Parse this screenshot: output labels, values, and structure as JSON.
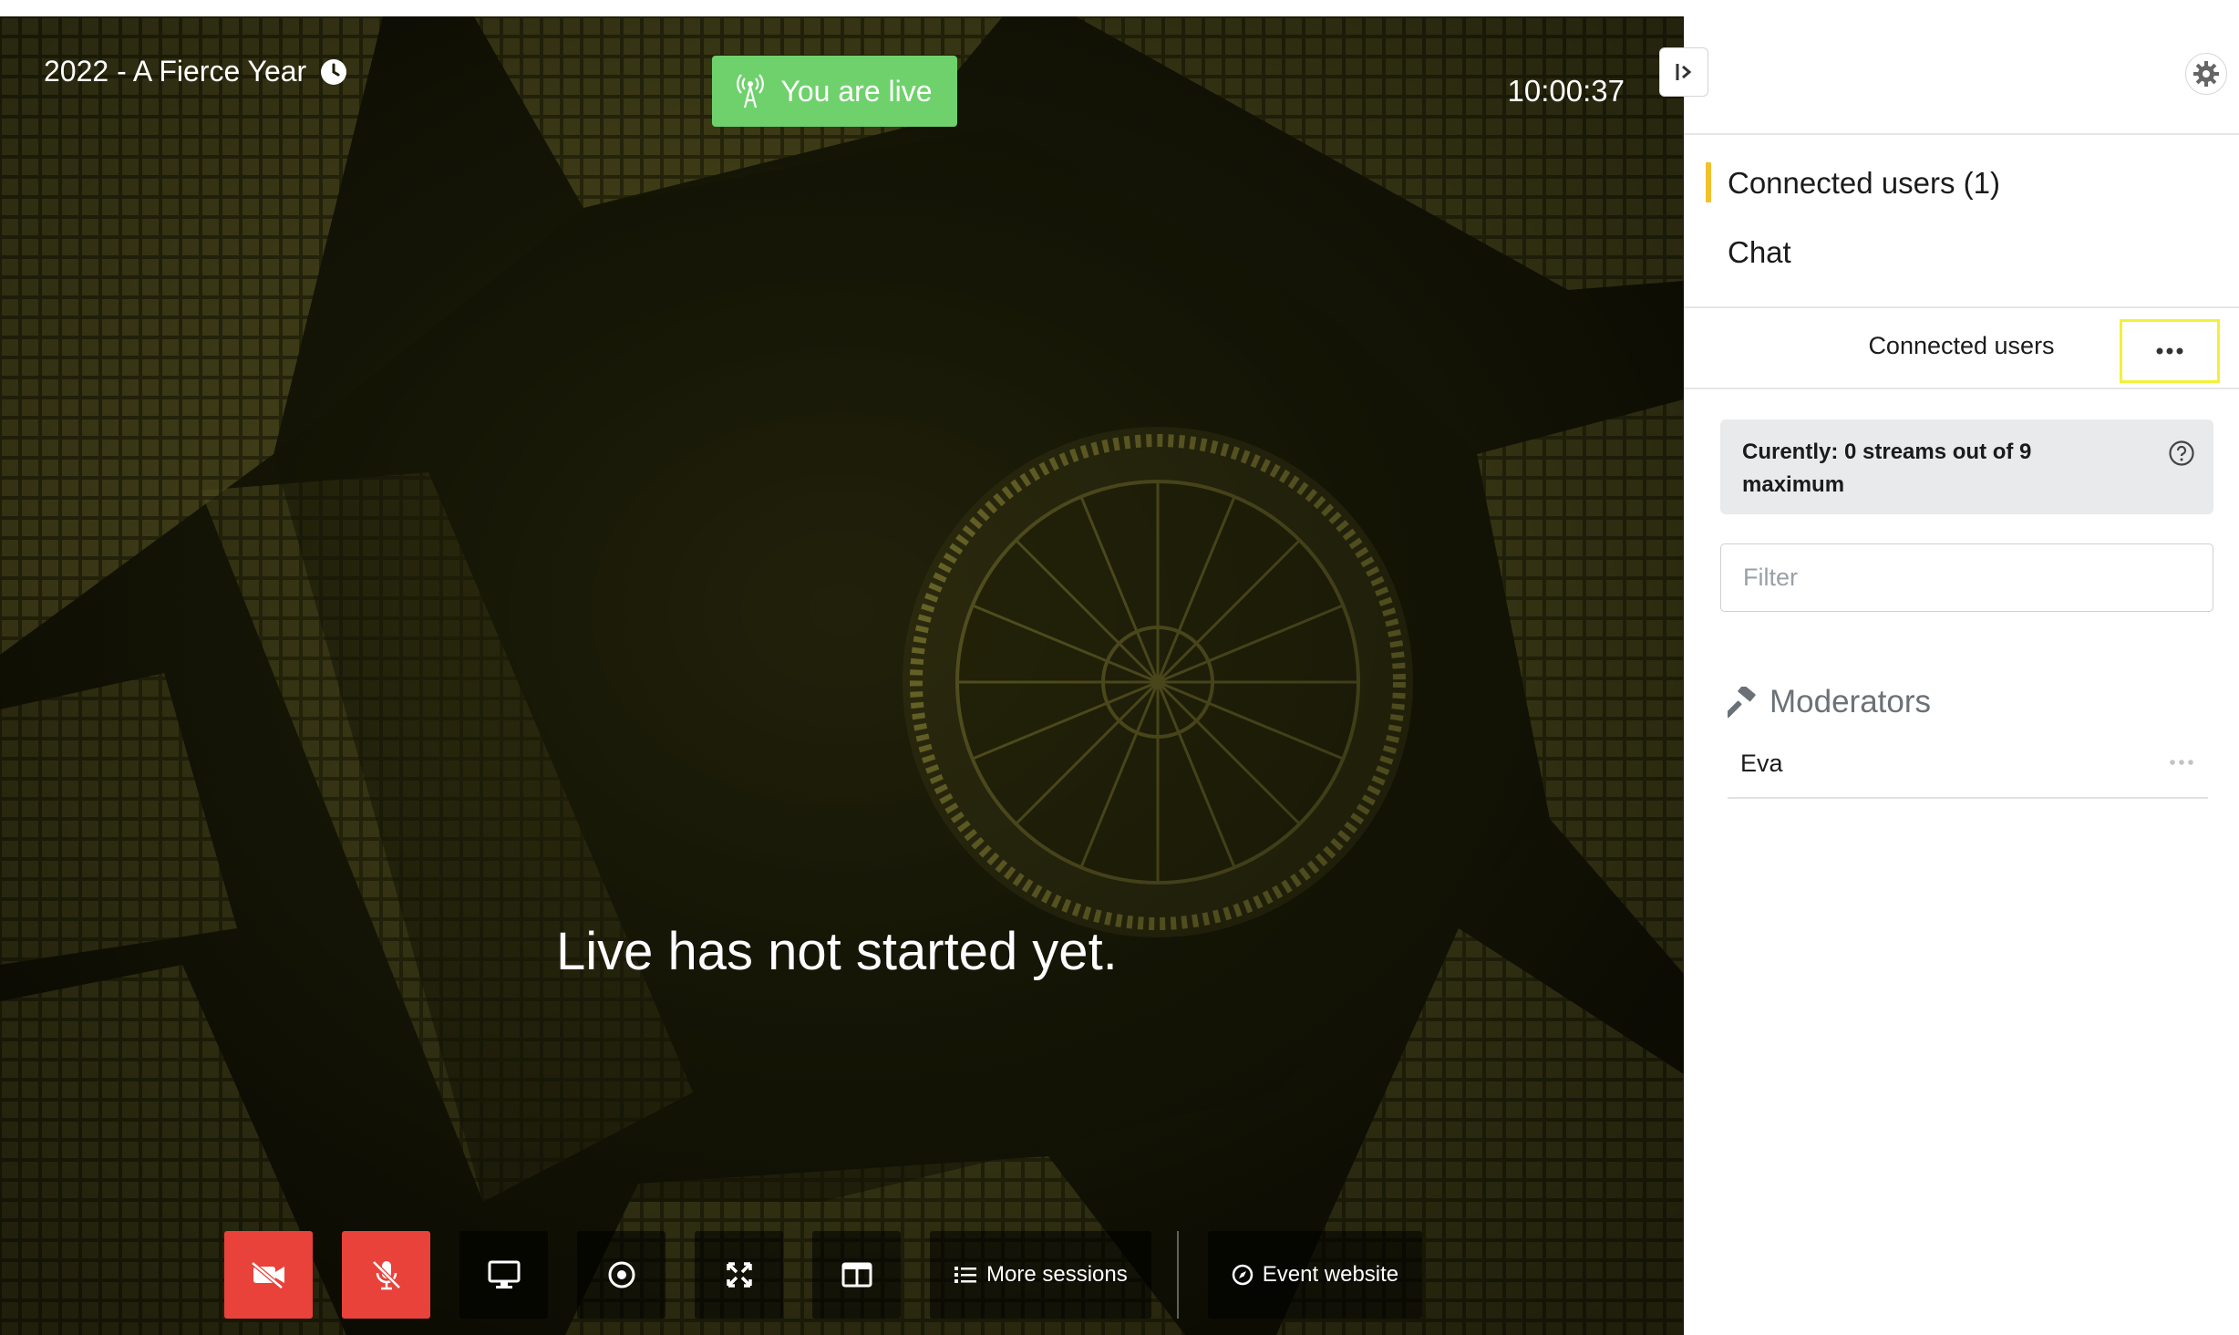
{
  "stage": {
    "event_title": "2022 - A Fierce Year",
    "live_badge": "You are live",
    "timer": "10:00:37",
    "notice": "Live has not started yet.",
    "colors": {
      "live_badge": "#6fd16c",
      "muted_button": "#e8423a"
    }
  },
  "toolbar": {
    "buttons": [
      {
        "icon": "video-off-icon",
        "state": "muted"
      },
      {
        "icon": "mic-off-icon",
        "state": "muted"
      },
      {
        "icon": "screen-share-icon"
      },
      {
        "icon": "record-icon"
      },
      {
        "icon": "fullscreen-icon"
      },
      {
        "icon": "layout-icon"
      }
    ],
    "more_sessions_label": "More sessions",
    "event_website_label": "Event website"
  },
  "sidebar": {
    "tabs": [
      {
        "label": "Connected users (1)",
        "active": true
      },
      {
        "label": "Chat",
        "active": false
      }
    ],
    "panel_title": "Connected users",
    "stream_info": "Curently: 0 streams out of 9 maximum",
    "filter_placeholder": "Filter",
    "moderators_heading": "Moderators",
    "users": [
      {
        "name": "Eva"
      }
    ],
    "accent_color": "#f2c029"
  }
}
